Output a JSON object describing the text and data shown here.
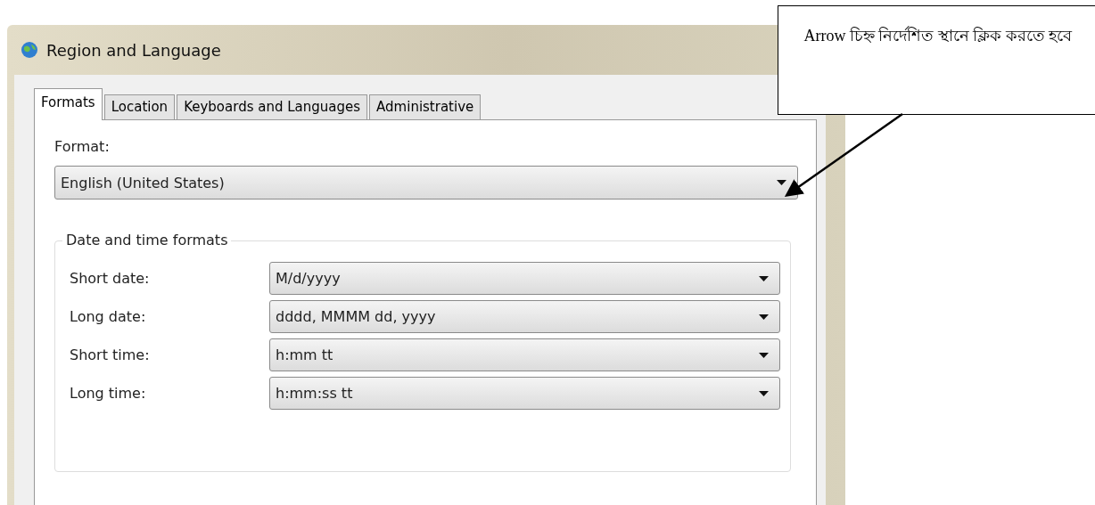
{
  "window": {
    "title": "Region and Language"
  },
  "tabs": [
    {
      "label": "Formats",
      "selected": true
    },
    {
      "label": "Location",
      "selected": false
    },
    {
      "label": "Keyboards and Languages",
      "selected": false
    },
    {
      "label": "Administrative",
      "selected": false
    }
  ],
  "format": {
    "label": "Format:",
    "value": "English (United States)"
  },
  "date_time_formats": {
    "title": "Date and time formats",
    "rows": [
      {
        "label": "Short date:",
        "value": "M/d/yyyy"
      },
      {
        "label": "Long date:",
        "value": "dddd, MMMM dd, yyyy"
      },
      {
        "label": "Short time:",
        "value": "h:mm tt"
      },
      {
        "label": "Long time:",
        "value": "h:mm:ss tt"
      }
    ]
  },
  "callout": {
    "text": "Arrow চিহ্ন নির্দেশিত স্থানে ক্লিক করতে হবে"
  }
}
